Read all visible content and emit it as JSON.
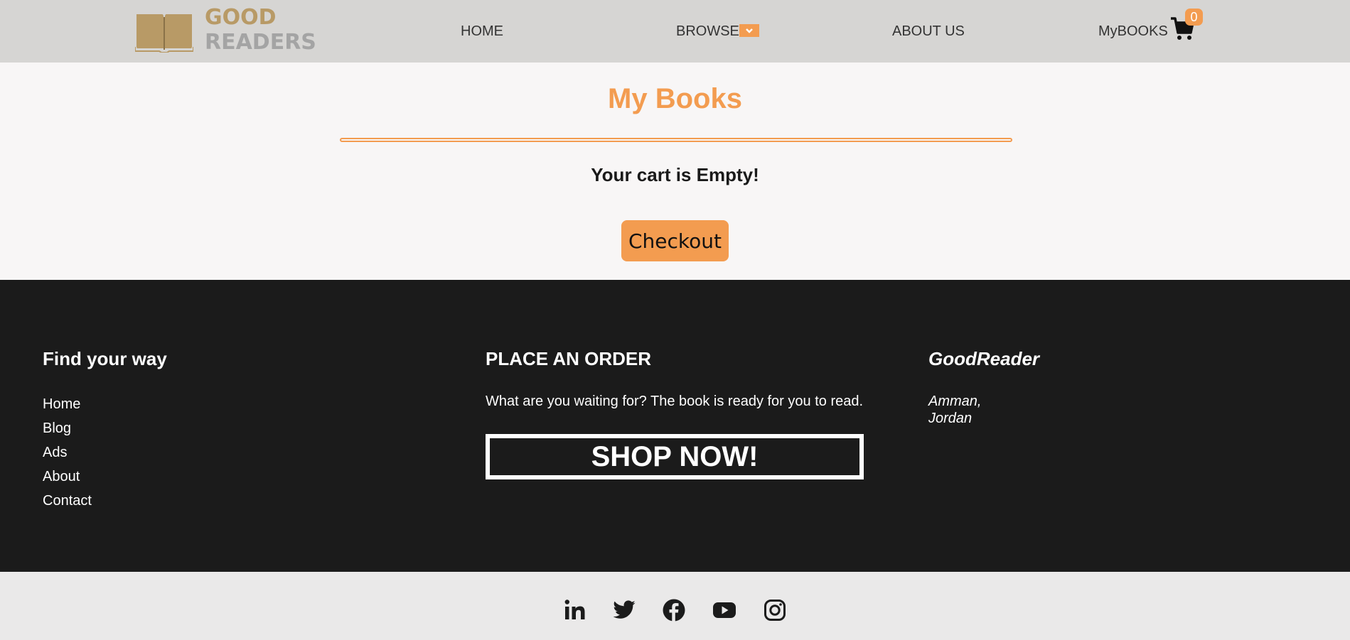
{
  "brand": {
    "line1": "GOOD",
    "line2": "READERS"
  },
  "nav": {
    "home": "HOME",
    "browse": "BROWSE",
    "about": "ABOUT US",
    "mybooks": "MyBOOKS",
    "cart_count": "0"
  },
  "page": {
    "title": "My Books",
    "empty_message": "Your cart is Empty!",
    "checkout": "Checkout"
  },
  "footer": {
    "col1": {
      "heading": "Find your way",
      "links": [
        "Home",
        "Blog",
        "Ads",
        "About",
        "Contact"
      ]
    },
    "col2": {
      "heading": "PLACE AN ORDER",
      "text": "What are you waiting for? The book is ready for you to read.",
      "button": "SHOP NOW!"
    },
    "col3": {
      "heading": "GoodReader",
      "city": "Amman,",
      "country": "Jordan"
    }
  },
  "social": [
    "linkedin-icon",
    "twitter-icon",
    "facebook-icon",
    "youtube-icon",
    "instagram-icon"
  ],
  "colors": {
    "accent": "#f39c50",
    "nav_bg": "#d6d5d3",
    "footer_bg": "#1b1b1b",
    "social_bg": "#eae9e9"
  }
}
